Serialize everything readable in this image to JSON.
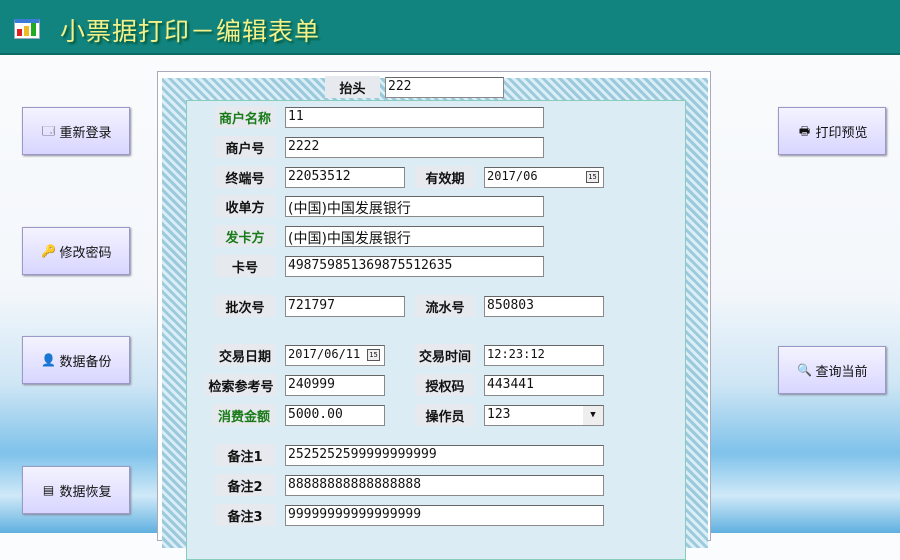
{
  "header": {
    "title": "小票据打印－编辑表单"
  },
  "left_buttons": [
    {
      "label": "重新登录",
      "icon": "relogin-icon"
    },
    {
      "label": "修改密码",
      "icon": "key-icon"
    },
    {
      "label": "数据备份",
      "icon": "backup-icon"
    },
    {
      "label": "数据恢复",
      "icon": "restore-icon"
    }
  ],
  "right_buttons": [
    {
      "label": "打印预览",
      "icon": "printer-icon"
    },
    {
      "label": "查询当前",
      "icon": "magnifier-icon"
    }
  ],
  "form": {
    "header_label": "抬头",
    "header_value": "222",
    "merchant_name_label": "商户名称",
    "merchant_name": "11",
    "merchant_no_label": "商户号",
    "merchant_no": "2222",
    "terminal_label": "终端号",
    "terminal": "22053512",
    "expiry_label": "有效期",
    "expiry": "2017/06",
    "acquirer_label": "收单方",
    "acquirer": "(中国)中国发展银行",
    "issuer_label": "发卡方",
    "issuer": "(中国)中国发展银行",
    "card_label": "卡号",
    "card": "498759851369875512635",
    "batch_label": "批次号",
    "batch": "721797",
    "serial_label": "流水号",
    "serial": "850803",
    "date_label": "交易日期",
    "date": "2017/06/11",
    "time_label": "交易时间",
    "time": "12:23:12",
    "ref_label": "检索参考号",
    "ref": "240999",
    "auth_label": "授权码",
    "auth": "443441",
    "amount_label": "消费金额",
    "amount": "5000.00",
    "operator_label": "操作员",
    "operator": "123",
    "note1_label": "备注1",
    "note1": "2525252599999999999",
    "note2_label": "备注2",
    "note2": "88888888888888888",
    "note3_label": "备注3",
    "note3": "99999999999999999"
  }
}
